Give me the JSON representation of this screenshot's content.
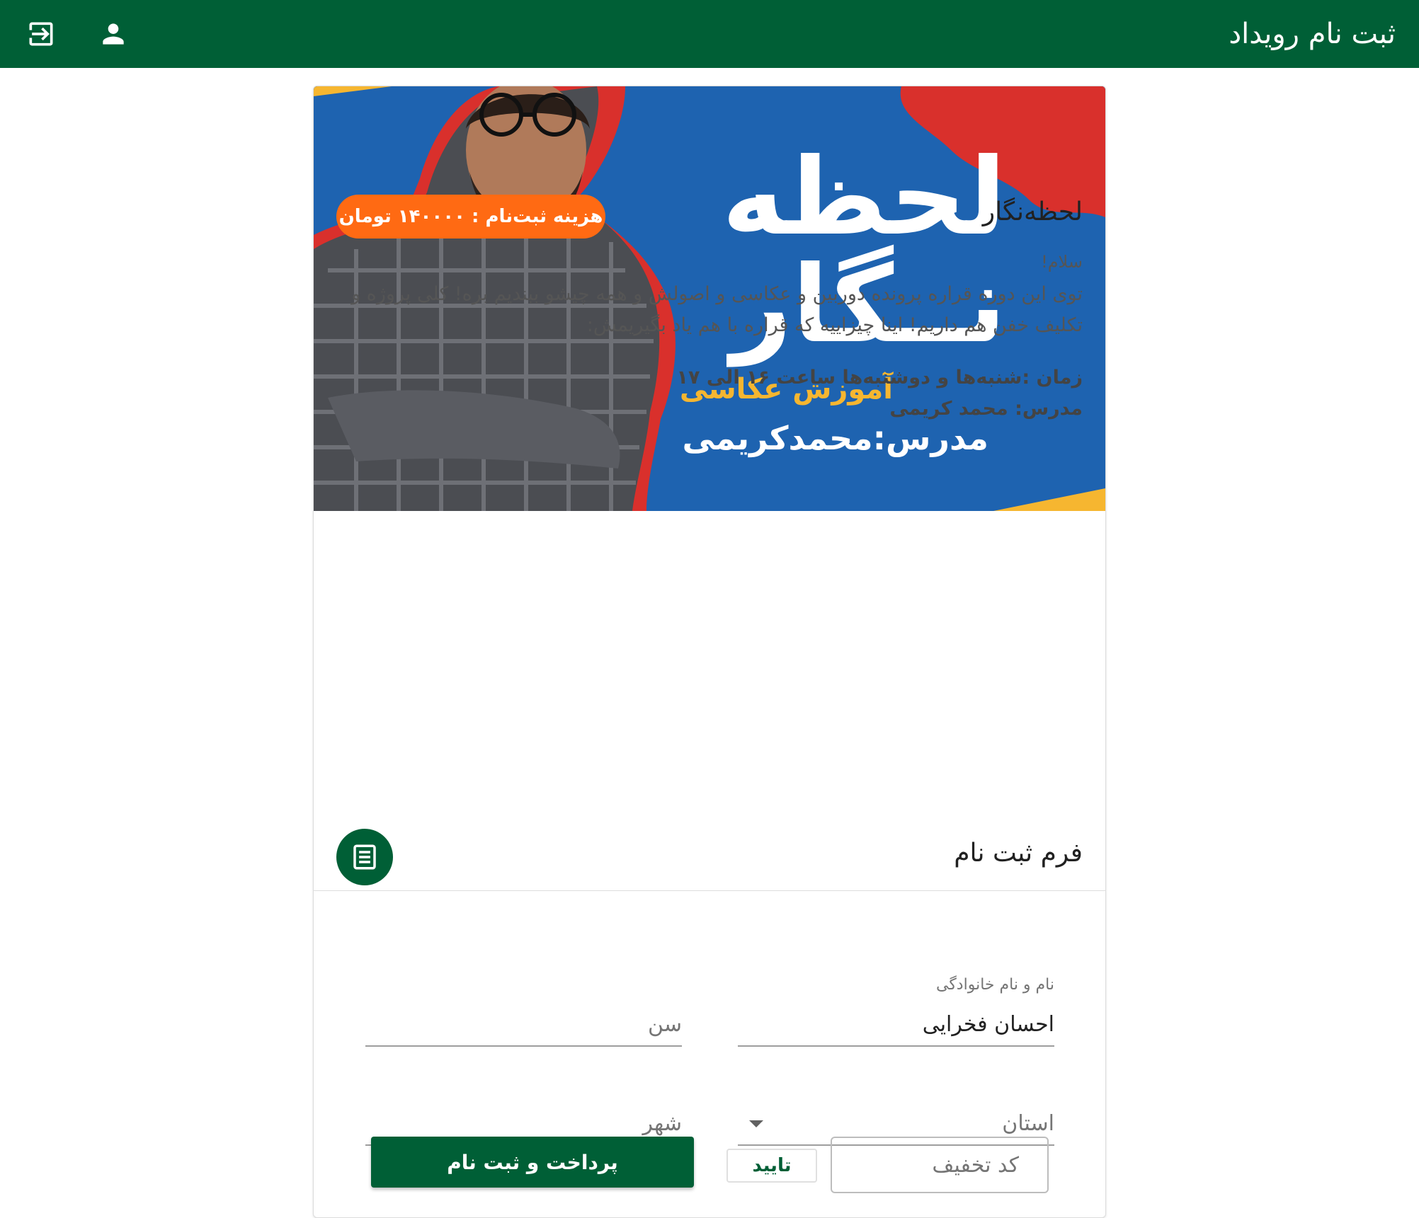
{
  "app_bar": {
    "title": "ثبت نام رویداد",
    "icons": [
      "logout-icon",
      "account-icon"
    ]
  },
  "banner": {
    "title_line1": "لحظه",
    "title_line2": "نــگار",
    "subtitle": "آموزش عکاسی",
    "teacher_prefix": "مدرس:",
    "teacher_name": "محمدکریمی"
  },
  "event": {
    "title": "لحظه‌نگار",
    "price_badge": "هزینه ثبت‌نام : ۱۴۰۰۰۰ تومان",
    "greeting": "سلام!",
    "description": "توی این دوره قراره پرونده دوربین و عکاسی و اصولش و همه چیشو ببندیم بره! کلی پروژه و تکلیف خفن هم داریم! اینا چیزاییه که قراره با هم یاد بگیریمش:",
    "schedule": "زمان :شنبه‌ها و دوشنبه‌ها ساعت ۱۶ الی ۱۷",
    "teacher": "مدرس: محمد کریمی"
  },
  "form": {
    "title": "فرم ثبت نام",
    "icon": "form-icon",
    "fullname_label": "نام و نام خانوادگی",
    "fullname_value": "احسان فخرایی",
    "age_placeholder": "سن",
    "province_placeholder": "استان",
    "city_placeholder": "شهر",
    "discount_placeholder": "کد تخفیف",
    "confirm_label": "تایید",
    "submit_label": "پرداخت و ثبت نام"
  },
  "colors": {
    "primary": "#005f36",
    "badge": "#ff6a13",
    "banner_blue": "#1e63b0",
    "banner_red": "#d9302c",
    "banner_yellow": "#f6b630"
  }
}
